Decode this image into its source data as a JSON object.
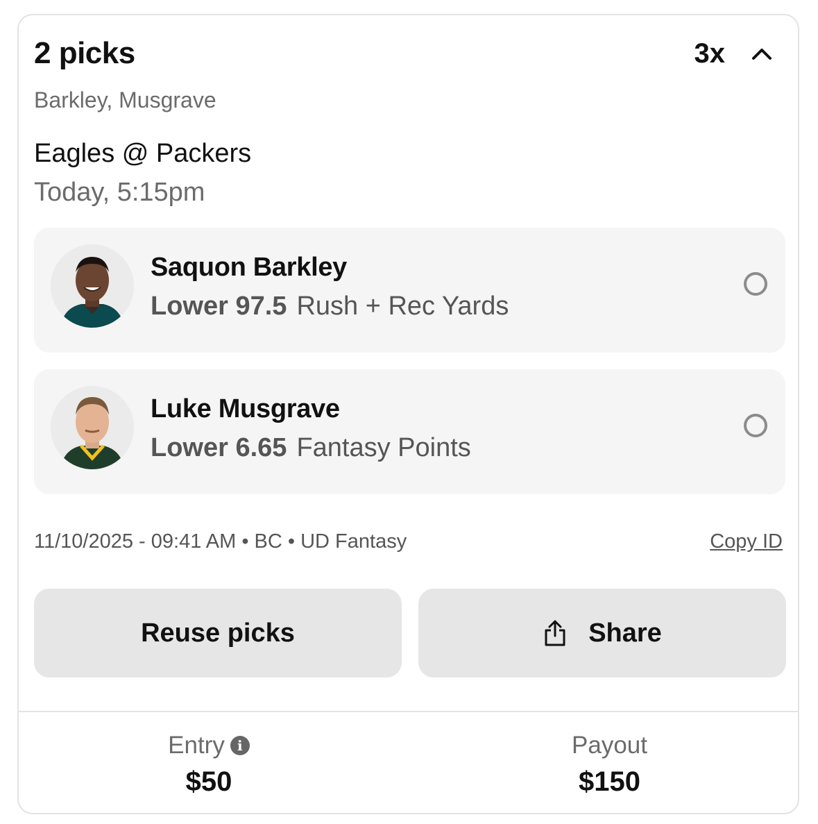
{
  "header": {
    "title": "2 picks",
    "multiplier": "3x",
    "players_summary": "Barkley, Musgrave"
  },
  "game": {
    "matchup": "Eagles @ Packers",
    "time": "Today, 5:15pm"
  },
  "picks": [
    {
      "player": "Saquon Barkley",
      "direction": "Lower",
      "line": "97.5",
      "stat": "Rush + Rec Yards",
      "jersey_color": "#0b4a4f"
    },
    {
      "player": "Luke Musgrave",
      "direction": "Lower",
      "line": "6.65",
      "stat": "Fantasy Points",
      "jersey_color": "#1f3d2b"
    }
  ],
  "meta": {
    "info": "11/10/2025 - 09:41 AM • BC • UD Fantasy",
    "copy_label": "Copy ID"
  },
  "actions": {
    "reuse_label": "Reuse picks",
    "share_label": "Share"
  },
  "footer": {
    "entry_label": "Entry",
    "entry_value": "$50",
    "payout_label": "Payout",
    "payout_value": "$150"
  }
}
